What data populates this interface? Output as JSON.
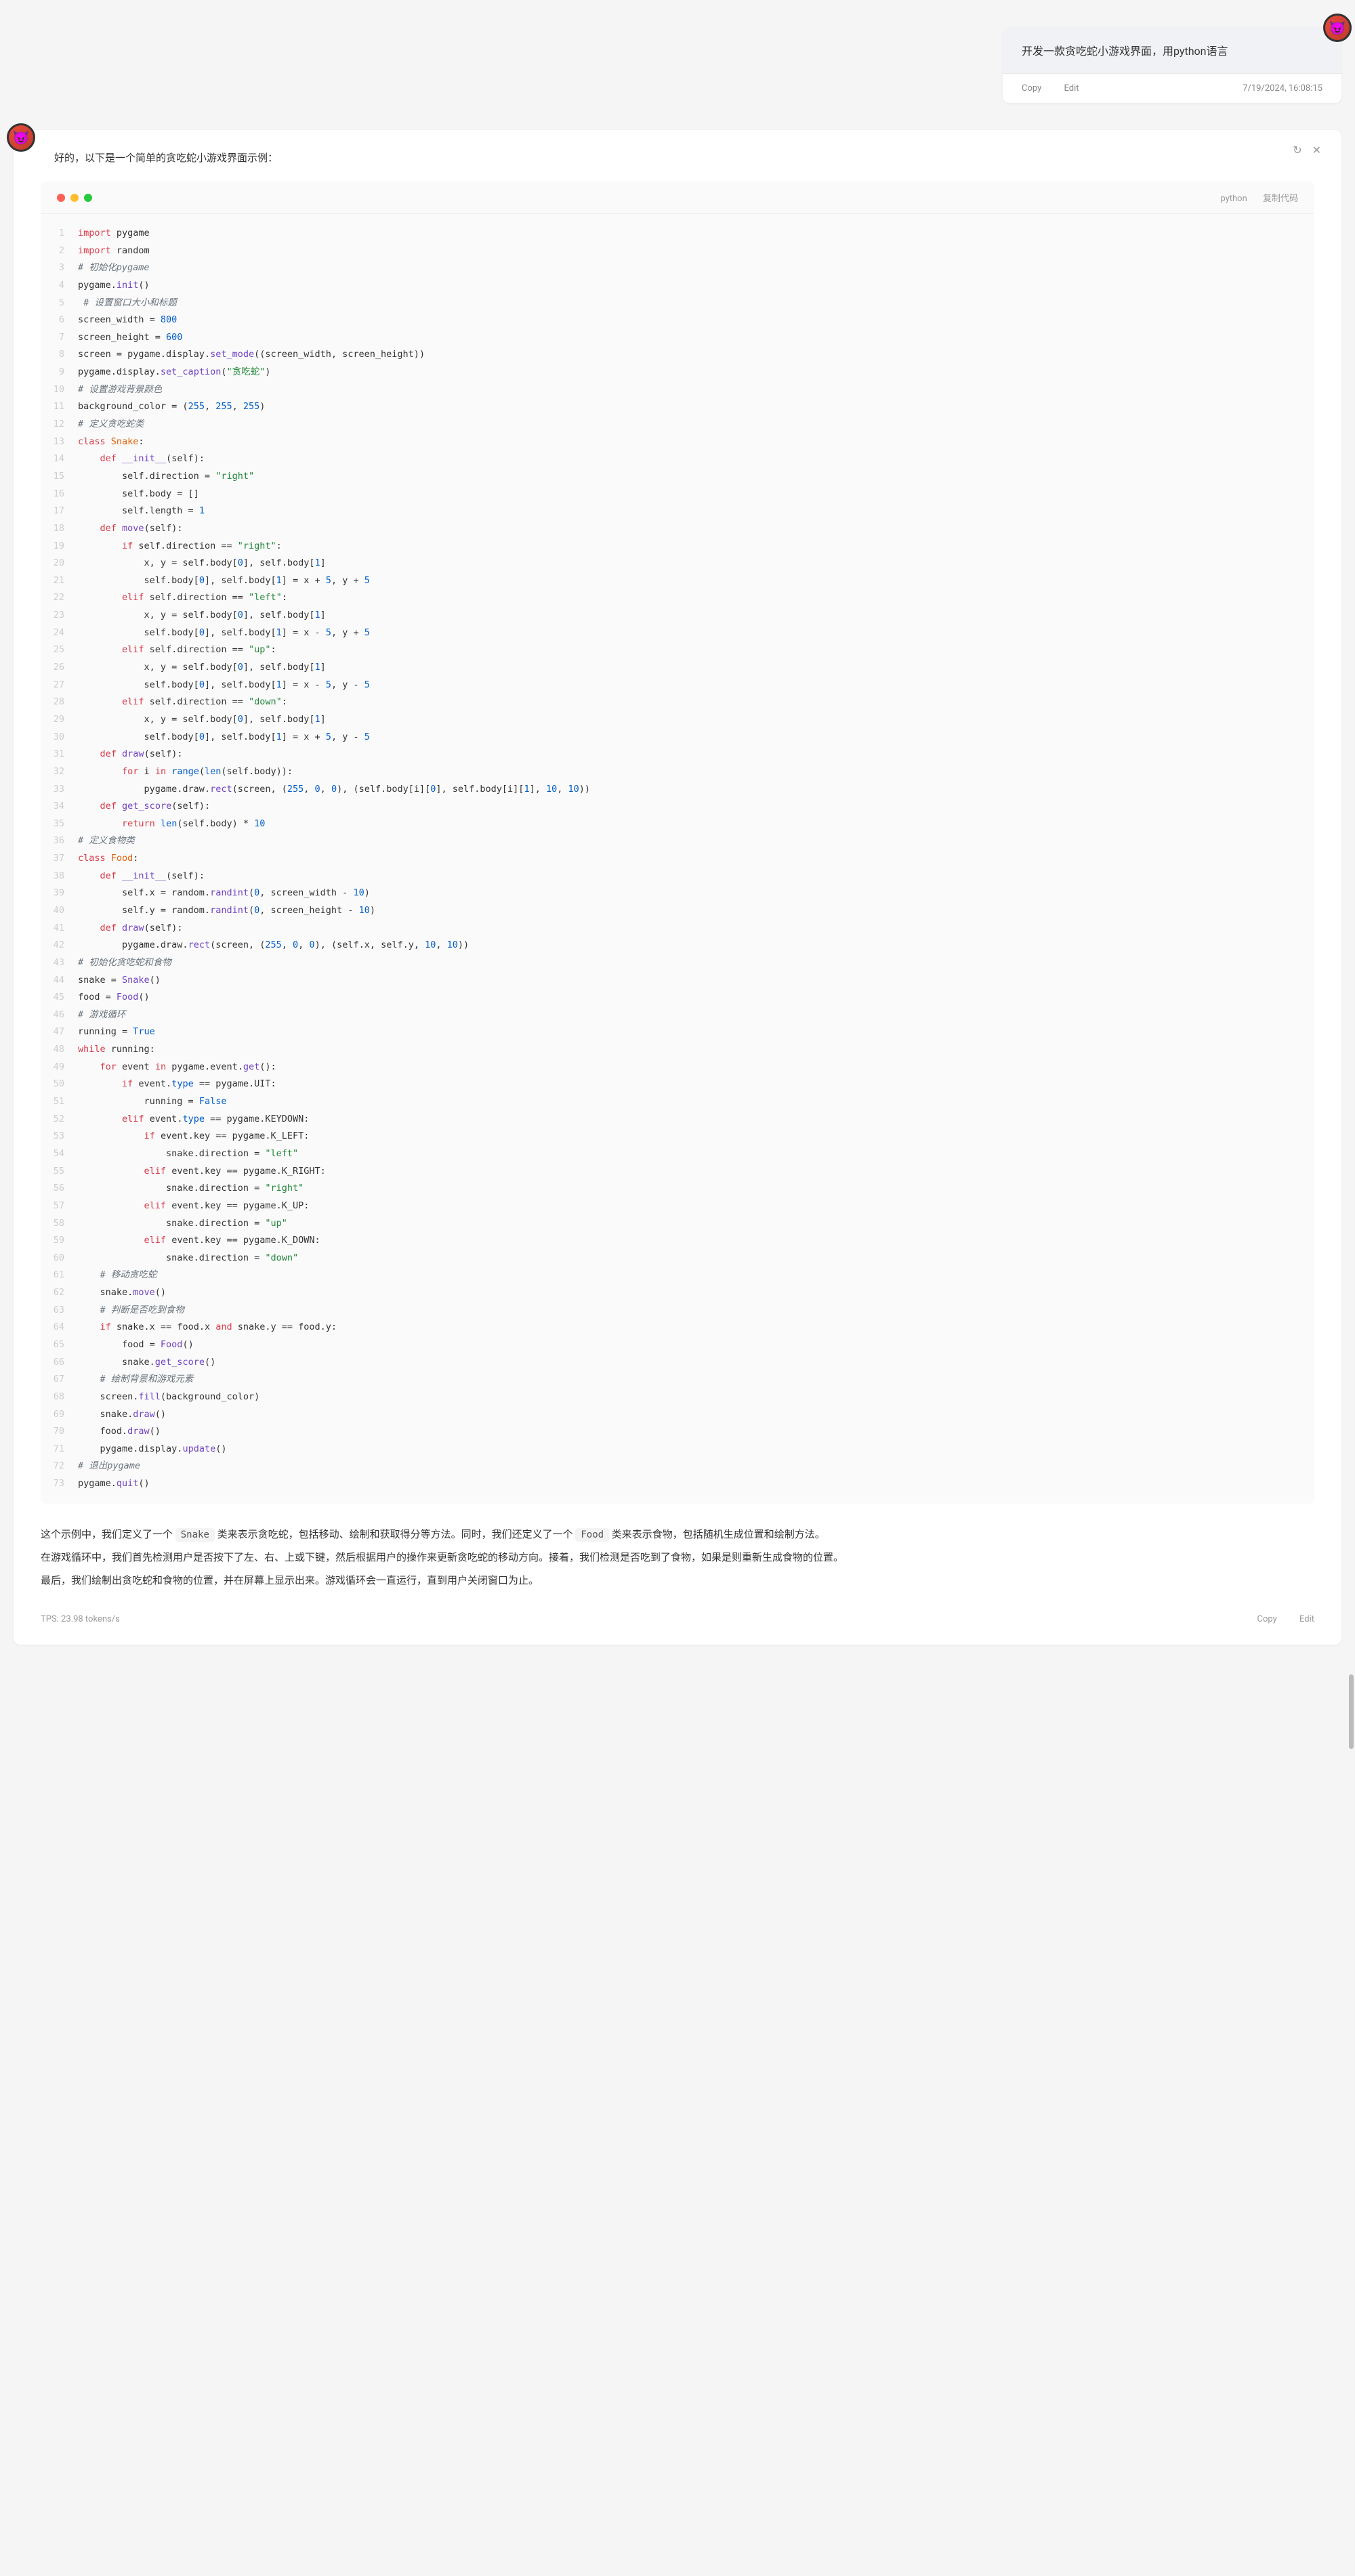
{
  "user_message": {
    "content": "开发一款贪吃蛇小游戏界面，用python语言",
    "copy_label": "Copy",
    "edit_label": "Edit",
    "timestamp": "7/19/2024, 16:08:15"
  },
  "bot": {
    "intro": "好的，以下是一个简单的贪吃蛇小游戏界面示例：",
    "refresh_icon": "↻",
    "close_icon": "✕"
  },
  "code": {
    "language": "python",
    "copy_label": "复制代码",
    "lines": [
      {
        "n": 1,
        "h": "<span class='kw'>import</span> pygame"
      },
      {
        "n": 2,
        "h": "<span class='kw'>import</span> random"
      },
      {
        "n": 3,
        "h": "<span class='cm'># 初始化pygame</span>"
      },
      {
        "n": 4,
        "h": "pygame.<span class='fn'>init</span>()"
      },
      {
        "n": 5,
        "h": " <span class='cm'># 设置窗口大小和标题</span>"
      },
      {
        "n": 6,
        "h": "screen_width = <span class='num'>800</span>"
      },
      {
        "n": 7,
        "h": "screen_height = <span class='num'>600</span>"
      },
      {
        "n": 8,
        "h": "screen = pygame.display.<span class='fn'>set_mode</span>((screen_width, screen_height))"
      },
      {
        "n": 9,
        "h": "pygame.display.<span class='fn'>set_caption</span>(<span class='str'>\"贪吃蛇\"</span>)"
      },
      {
        "n": 10,
        "h": "<span class='cm'># 设置游戏背景颜色</span>"
      },
      {
        "n": 11,
        "h": "background_color = (<span class='num'>255</span>, <span class='num'>255</span>, <span class='num'>255</span>)"
      },
      {
        "n": 12,
        "h": "<span class='cm'># 定义贪吃蛇类</span>"
      },
      {
        "n": 13,
        "h": "<span class='kw'>class</span> <span class='cls'>Snake</span>:"
      },
      {
        "n": 14,
        "h": "    <span class='kw'>def</span> <span class='fn'>__init__</span>(self):"
      },
      {
        "n": 15,
        "h": "        self.direction = <span class='str'>\"right\"</span>"
      },
      {
        "n": 16,
        "h": "        self.body = []"
      },
      {
        "n": 17,
        "h": "        self.length = <span class='num'>1</span>"
      },
      {
        "n": 18,
        "h": "    <span class='kw'>def</span> <span class='fn'>move</span>(self):"
      },
      {
        "n": 19,
        "h": "        <span class='kw'>if</span> self.direction == <span class='str'>\"right\"</span>:"
      },
      {
        "n": 20,
        "h": "            x, y = self.body[<span class='num'>0</span>], self.body[<span class='num'>1</span>]"
      },
      {
        "n": 21,
        "h": "            self.body[<span class='num'>0</span>], self.body[<span class='num'>1</span>] = x + <span class='num'>5</span>, y + <span class='num'>5</span>"
      },
      {
        "n": 22,
        "h": "        <span class='kw'>elif</span> self.direction == <span class='str'>\"left\"</span>:"
      },
      {
        "n": 23,
        "h": "            x, y = self.body[<span class='num'>0</span>], self.body[<span class='num'>1</span>]"
      },
      {
        "n": 24,
        "h": "            self.body[<span class='num'>0</span>], self.body[<span class='num'>1</span>] = x - <span class='num'>5</span>, y + <span class='num'>5</span>"
      },
      {
        "n": 25,
        "h": "        <span class='kw'>elif</span> self.direction == <span class='str'>\"up\"</span>:"
      },
      {
        "n": 26,
        "h": "            x, y = self.body[<span class='num'>0</span>], self.body[<span class='num'>1</span>]"
      },
      {
        "n": 27,
        "h": "            self.body[<span class='num'>0</span>], self.body[<span class='num'>1</span>] = x - <span class='num'>5</span>, y - <span class='num'>5</span>"
      },
      {
        "n": 28,
        "h": "        <span class='kw'>elif</span> self.direction == <span class='str'>\"down\"</span>:"
      },
      {
        "n": 29,
        "h": "            x, y = self.body[<span class='num'>0</span>], self.body[<span class='num'>1</span>]"
      },
      {
        "n": 30,
        "h": "            self.body[<span class='num'>0</span>], self.body[<span class='num'>1</span>] = x + <span class='num'>5</span>, y - <span class='num'>5</span>"
      },
      {
        "n": 31,
        "h": "    <span class='kw'>def</span> <span class='fn'>draw</span>(self):"
      },
      {
        "n": 32,
        "h": "        <span class='kw'>for</span> i <span class='kw'>in</span> <span class='bi'>range</span>(<span class='bi'>len</span>(self.body)):"
      },
      {
        "n": 33,
        "h": "            pygame.draw.<span class='fn'>rect</span>(screen, (<span class='num'>255</span>, <span class='num'>0</span>, <span class='num'>0</span>), (self.body[i][<span class='num'>0</span>], self.body[i][<span class='num'>1</span>], <span class='num'>10</span>, <span class='num'>10</span>))"
      },
      {
        "n": 34,
        "h": "    <span class='kw'>def</span> <span class='fn'>get_score</span>(self):"
      },
      {
        "n": 35,
        "h": "        <span class='kw'>return</span> <span class='bi'>len</span>(self.body) * <span class='num'>10</span>"
      },
      {
        "n": 36,
        "h": "<span class='cm'># 定义食物类</span>"
      },
      {
        "n": 37,
        "h": "<span class='kw'>class</span> <span class='cls'>Food</span>:"
      },
      {
        "n": 38,
        "h": "    <span class='kw'>def</span> <span class='fn'>__init__</span>(self):"
      },
      {
        "n": 39,
        "h": "        self.x = random.<span class='fn'>randint</span>(<span class='num'>0</span>, screen_width - <span class='num'>10</span>)"
      },
      {
        "n": 40,
        "h": "        self.y = random.<span class='fn'>randint</span>(<span class='num'>0</span>, screen_height - <span class='num'>10</span>)"
      },
      {
        "n": 41,
        "h": "    <span class='kw'>def</span> <span class='fn'>draw</span>(self):"
      },
      {
        "n": 42,
        "h": "        pygame.draw.<span class='fn'>rect</span>(screen, (<span class='num'>255</span>, <span class='num'>0</span>, <span class='num'>0</span>), (self.x, self.y, <span class='num'>10</span>, <span class='num'>10</span>))"
      },
      {
        "n": 43,
        "h": "<span class='cm'># 初始化贪吃蛇和食物</span>"
      },
      {
        "n": 44,
        "h": "snake = <span class='fn'>Snake</span>()"
      },
      {
        "n": 45,
        "h": "food = <span class='fn'>Food</span>()"
      },
      {
        "n": 46,
        "h": "<span class='cm'># 游戏循环</span>"
      },
      {
        "n": 47,
        "h": "running = <span class='bi'>True</span>"
      },
      {
        "n": 48,
        "h": "<span class='kw'>while</span> running:"
      },
      {
        "n": 49,
        "h": "    <span class='kw'>for</span> event <span class='kw'>in</span> pygame.event.<span class='fn'>get</span>():"
      },
      {
        "n": 50,
        "h": "        <span class='kw'>if</span> event.<span class='bi'>type</span> == pygame.UIT:"
      },
      {
        "n": 51,
        "h": "            running = <span class='bi'>False</span>"
      },
      {
        "n": 52,
        "h": "        <span class='kw'>elif</span> event.<span class='bi'>type</span> == pygame.KEYDOWN:"
      },
      {
        "n": 53,
        "h": "            <span class='kw'>if</span> event.key == pygame.K_LEFT:"
      },
      {
        "n": 54,
        "h": "                snake.direction = <span class='str'>\"left\"</span>"
      },
      {
        "n": 55,
        "h": "            <span class='kw'>elif</span> event.key == pygame.K_RIGHT:"
      },
      {
        "n": 56,
        "h": "                snake.direction = <span class='str'>\"right\"</span>"
      },
      {
        "n": 57,
        "h": "            <span class='kw'>elif</span> event.key == pygame.K_UP:"
      },
      {
        "n": 58,
        "h": "                snake.direction = <span class='str'>\"up\"</span>"
      },
      {
        "n": 59,
        "h": "            <span class='kw'>elif</span> event.key == pygame.K_DOWN:"
      },
      {
        "n": 60,
        "h": "                snake.direction = <span class='str'>\"down\"</span>"
      },
      {
        "n": 61,
        "h": "    <span class='cm'># 移动贪吃蛇</span>"
      },
      {
        "n": 62,
        "h": "    snake.<span class='fn'>move</span>()"
      },
      {
        "n": 63,
        "h": "    <span class='cm'># 判断是否吃到食物</span>"
      },
      {
        "n": 64,
        "h": "    <span class='kw'>if</span> snake.x == food.x <span class='kw'>and</span> snake.y == food.y:"
      },
      {
        "n": 65,
        "h": "        food = <span class='fn'>Food</span>()"
      },
      {
        "n": 66,
        "h": "        snake.<span class='fn'>get_score</span>()"
      },
      {
        "n": 67,
        "h": "    <span class='cm'># 绘制背景和游戏元素</span>"
      },
      {
        "n": 68,
        "h": "    screen.<span class='fn'>fill</span>(background_color)"
      },
      {
        "n": 69,
        "h": "    snake.<span class='fn'>draw</span>()"
      },
      {
        "n": 70,
        "h": "    food.<span class='fn'>draw</span>()"
      },
      {
        "n": 71,
        "h": "    pygame.display.<span class='fn'>update</span>()"
      },
      {
        "n": 72,
        "h": "<span class='cm'># 退出pygame</span>"
      },
      {
        "n": 73,
        "h": "pygame.<span class='fn'>quit</span>()"
      }
    ]
  },
  "explanation": {
    "p1_pre": "这个示例中，我们定义了一个 ",
    "p1_code1": "Snake",
    "p1_mid": " 类来表示贪吃蛇，包括移动、绘制和获取得分等方法。同时，我们还定义了一个 ",
    "p1_code2": "Food",
    "p1_post": " 类来表示食物，包括随机生成位置和绘制方法。",
    "p2": "在游戏循环中，我们首先检测用户是否按下了左、右、上或下键，然后根据用户的操作来更新贪吃蛇的移动方向。接着，我们检测是否吃到了食物，如果是则重新生成食物的位置。",
    "p3": "最后，我们绘制出贪吃蛇和食物的位置，并在屏幕上显示出来。游戏循环会一直运行，直到用户关闭窗口为止。"
  },
  "footer": {
    "tps": "TPS: 23.98 tokens/s",
    "copy_label": "Copy",
    "edit_label": "Edit"
  }
}
